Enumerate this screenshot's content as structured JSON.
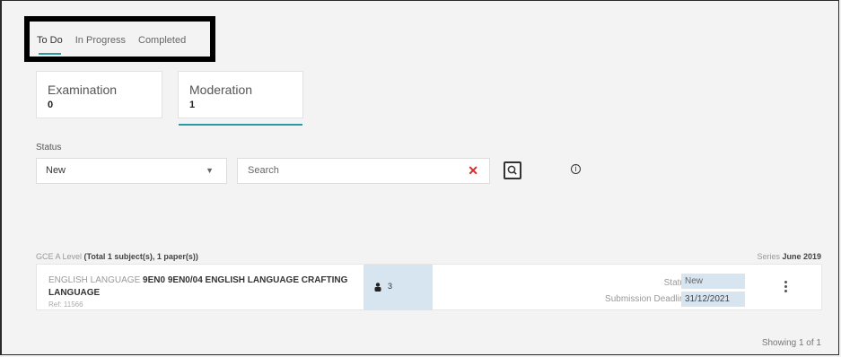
{
  "tabs": {
    "todo": "To Do",
    "in_progress": "In Progress",
    "completed": "Completed"
  },
  "cards": {
    "examination": {
      "title": "Examination",
      "count": "0"
    },
    "moderation": {
      "title": "Moderation",
      "count": "1"
    }
  },
  "filters": {
    "status_label": "Status",
    "status_value": "New",
    "search_placeholder": "Search"
  },
  "group": {
    "level": "GCE A Level",
    "summary": "(Total 1 subject(s), 1 paper(s))",
    "series_label": "Series",
    "series_value": "June 2019"
  },
  "row": {
    "subject_prefix": "ENGLISH LANGUAGE",
    "subject_code": "9EN0 9EN0/04 ENGLISH LANGUAGE CRAFTING LANGUAGE",
    "ref": "Ref: 11566",
    "count": "3",
    "status_label": "Status",
    "status_value": "New",
    "deadline_label": "Submission Deadline",
    "deadline_value": "31/12/2021"
  },
  "footer": {
    "showing": "Showing 1 of 1"
  },
  "colors": {
    "accent": "#2b98a6",
    "highlight_cell": "#d7e5f1",
    "clear_x": "#d62b2b"
  },
  "icons": [
    "caret-down-icon",
    "clear-icon",
    "search-icon",
    "info-icon",
    "person-icon",
    "kebab-menu-icon"
  ]
}
